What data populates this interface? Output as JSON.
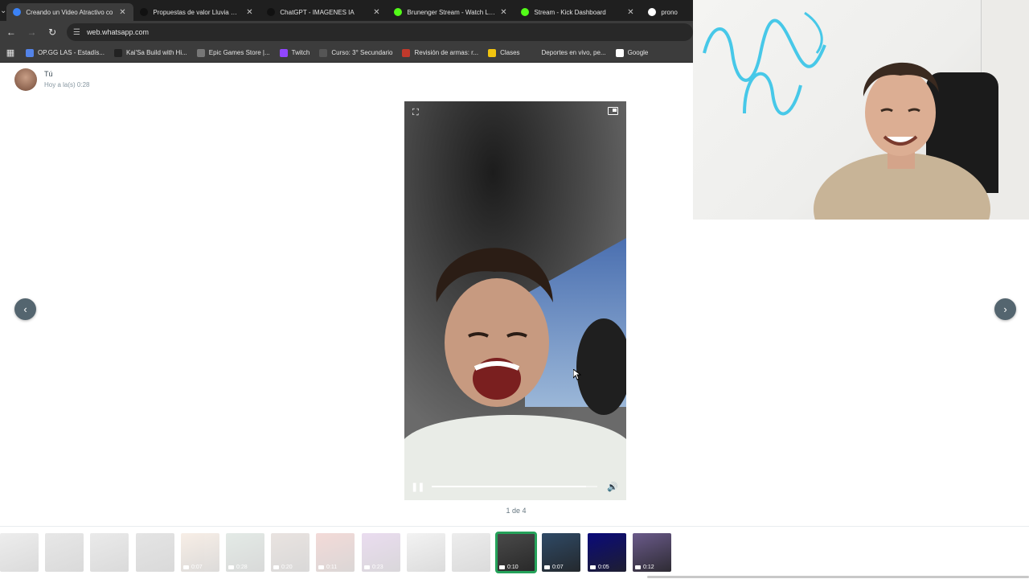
{
  "browser": {
    "tabs": [
      {
        "title": "Creando un Video Atractivo co",
        "favicon_color": "#3b82f6",
        "active": true
      },
      {
        "title": "Propuestas de valor Lluvia Cero",
        "favicon_color": "#111111",
        "active": false
      },
      {
        "title": "ChatGPT - IMAGENES IA",
        "favicon_color": "#111111",
        "active": false
      },
      {
        "title": "Brunenger Stream - Watch Live",
        "favicon_color": "#53fc18",
        "active": false
      },
      {
        "title": "Stream - Kick Dashboard",
        "favicon_color": "#53fc18",
        "active": false
      },
      {
        "title": "prono",
        "favicon_color": "#ffffff",
        "active": false
      }
    ],
    "address": "web.whatsapp.com",
    "bookmarks": [
      {
        "label": "OP.GG LAS - Estadís...",
        "color": "#5383e8"
      },
      {
        "label": "Kai'Sa Build with Hi...",
        "color": "#222222"
      },
      {
        "label": "Epic Games Store |...",
        "color": "#777777"
      },
      {
        "label": "Twitch",
        "color": "#9146ff"
      },
      {
        "label": "Curso: 3° Secundario",
        "color": "#555555"
      },
      {
        "label": "Revisión de armas: r...",
        "color": "#c0392b"
      },
      {
        "label": "Clases",
        "color": "#f1c40f"
      },
      {
        "label": "Deportes en vivo, pe...",
        "color": "#3c3c3c"
      },
      {
        "label": "Google",
        "color": "#ffffff"
      }
    ]
  },
  "chat": {
    "sender": "Tú",
    "timestamp": "Hoy a la(s) 0:28"
  },
  "viewer": {
    "counter": "1 de 4",
    "prev_icon": "chevron-left-icon",
    "next_icon": "chevron-right-icon",
    "playback_progress": 0.93
  },
  "thumbnails": [
    {
      "duration": "",
      "faded": true,
      "tone": "#9a9a9a"
    },
    {
      "duration": "",
      "faded": true,
      "tone": "#7a7a7a"
    },
    {
      "duration": "",
      "faded": true,
      "tone": "#8a8a8a"
    },
    {
      "duration": "",
      "faded": true,
      "tone": "#6a6a6a"
    },
    {
      "duration": "0:07",
      "faded": true,
      "tone": "#d9a57a"
    },
    {
      "duration": "0:28",
      "faded": true,
      "tone": "#6b8f7a"
    },
    {
      "duration": "0:20",
      "faded": true,
      "tone": "#8a6a5a"
    },
    {
      "duration": "0:11",
      "faded": true,
      "tone": "#c0392b"
    },
    {
      "duration": "0:23",
      "faded": true,
      "tone": "#8e44ad"
    },
    {
      "duration": "",
      "faded": true,
      "tone": "#bbbbbb"
    },
    {
      "duration": "",
      "faded": true,
      "tone": "#999999"
    },
    {
      "duration": "0:10",
      "faded": false,
      "selected": true,
      "tone": "#4a4a4a"
    },
    {
      "duration": "0:07",
      "faded": false,
      "tone": "#2f4a66"
    },
    {
      "duration": "0:05",
      "faded": false,
      "tone": "#0a0a7a"
    },
    {
      "duration": "0:12",
      "faded": false,
      "tone": "#6a5a8a"
    }
  ]
}
